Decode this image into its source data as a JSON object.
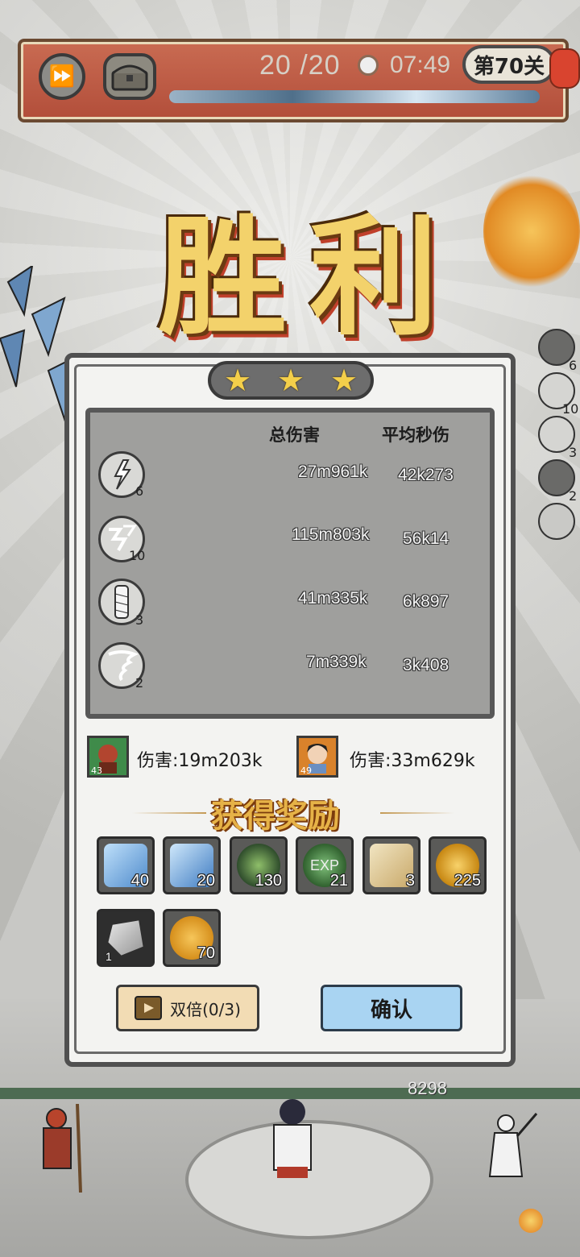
{
  "top_bar": {
    "wave": "20 /20",
    "timer": "07:49",
    "level": "第70关"
  },
  "victory_text": "胜利",
  "stars": 3,
  "stats": {
    "headers": {
      "total_damage": "总伤害",
      "avg_dps": "平均秒伤"
    },
    "rows": [
      {
        "icon": "lightning-skill-icon",
        "level": "6",
        "total": "27m961k",
        "dps": "42k273"
      },
      {
        "icon": "chain-lightning-skill-icon",
        "level": "10",
        "total": "115m803k",
        "dps": "56k14"
      },
      {
        "icon": "whirlwind-skill-icon",
        "level": "3",
        "total": "41m335k",
        "dps": "6k897"
      },
      {
        "icon": "tornado-skill-icon",
        "level": "2",
        "total": "7m339k",
        "dps": "3k408"
      }
    ]
  },
  "heroes": [
    {
      "level": "43",
      "damage": "伤害:19m203k",
      "color": "#3f8b4a"
    },
    {
      "level": "49",
      "damage": "伤害:33m629k",
      "color": "#d9822b"
    }
  ],
  "reward_title": "获得奖励",
  "rewards": [
    {
      "icon": "ice-scroll-icon",
      "count": "40",
      "color": "#5e9ad6"
    },
    {
      "icon": "ice-gem-icon",
      "count": "20",
      "color": "#5e9ad6"
    },
    {
      "icon": "jade-leaf-icon",
      "count": "130",
      "color": "#3c6a3a"
    },
    {
      "icon": "exp-orb-icon",
      "count": "21",
      "color": "#4f8a4a"
    },
    {
      "icon": "scroll-icon",
      "count": "3",
      "color": "#d8c48f"
    },
    {
      "icon": "gold-coin-icon",
      "count": "225",
      "color": "#e0a92a"
    },
    {
      "icon": "ore-stone-icon",
      "count": "1",
      "color": "#d9d9d6"
    },
    {
      "icon": "star-coin-icon",
      "count": "70",
      "color": "#e0a92a"
    }
  ],
  "buttons": {
    "double": "双倍(0/3)",
    "confirm": "确认"
  },
  "side_skills": [
    "6",
    "10",
    "3",
    "2"
  ],
  "ground": {
    "hp": "8298"
  },
  "colors": {
    "gold": "#f3d26b",
    "panel_bg": "#f3f3f1",
    "confirm_blue": "#a9d4f2",
    "double_tan": "#f2dcb4"
  }
}
